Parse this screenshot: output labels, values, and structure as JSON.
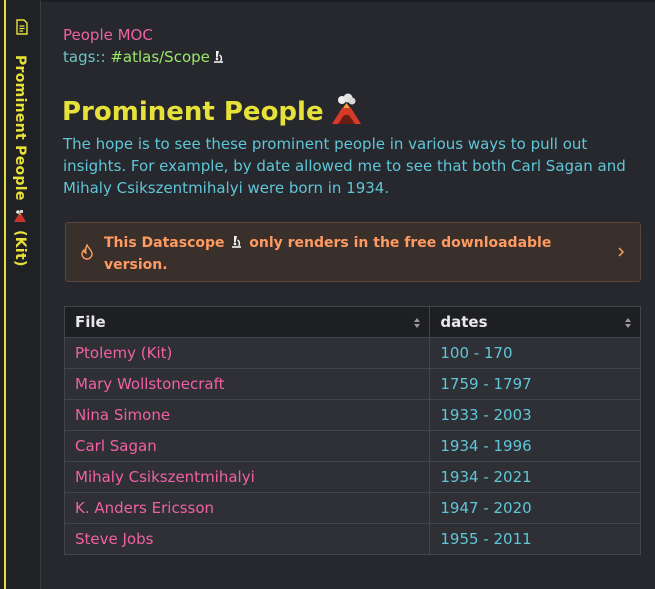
{
  "sidebar": {
    "tab_title": "Prominent People",
    "tab_suffix": "(Kit)",
    "doc_icon": "document-icon",
    "volcano_icon": "volcano-icon",
    "accent_color": "#e6e23a"
  },
  "note": {
    "title": "People MOC",
    "tags_label": "tags::",
    "tag": "#atlas/Scope",
    "scope_icon": "microscope-icon"
  },
  "content": {
    "heading": "Prominent People",
    "intro": "The hope is to see these prominent people in various ways to pull out insights. For example, by date allowed me to see that both Carl Sagan and Mihaly Csikszentmihalyi were born in 1934."
  },
  "callout": {
    "text_before": "This Datascope",
    "text_after": "only renders in the free downloadable version.",
    "icon": "flame-icon",
    "chevron": "chevron-right-icon"
  },
  "table": {
    "columns": [
      "File",
      "dates"
    ],
    "rows": [
      {
        "file": "Ptolemy (Kit)",
        "dates": "100 - 170"
      },
      {
        "file": "Mary Wollstonecraft",
        "dates": "1759 - 1797"
      },
      {
        "file": "Nina Simone",
        "dates": "1933 - 2003"
      },
      {
        "file": "Carl Sagan",
        "dates": "1934 - 1996"
      },
      {
        "file": "Mihaly Csikszentmihalyi",
        "dates": "1934 - 2021"
      },
      {
        "file": "K. Anders Ericsson",
        "dates": "1947 - 2020"
      },
      {
        "file": "Steve Jobs",
        "dates": "1955 - 2011"
      }
    ]
  },
  "colors": {
    "link_pink": "#f061a4",
    "text_cyan": "#5fc6d8",
    "tag_green": "#9be86a",
    "callout_orange": "#ff9a62"
  }
}
